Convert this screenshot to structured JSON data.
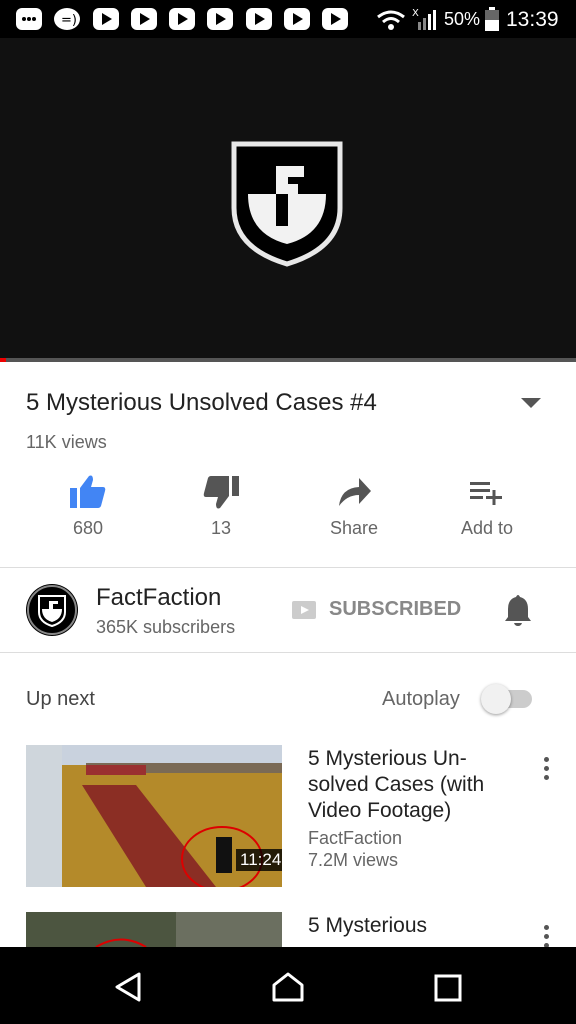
{
  "status_bar": {
    "battery": "50%",
    "time": "13:39",
    "icons": [
      "chat-icon",
      "messenger-icon",
      "youtube-icon",
      "youtube-icon",
      "youtube-icon",
      "youtube-icon",
      "youtube-icon",
      "youtube-icon",
      "youtube-icon",
      "wifi-icon",
      "signal-icon",
      "battery-icon"
    ]
  },
  "player": {
    "progress_fraction": 0.01,
    "logo": "factfaction-shield-logo"
  },
  "video": {
    "title": "5 Mysterious Unsolved Cases #4",
    "views": "11K views",
    "actions": {
      "like_count": "680",
      "dislike_count": "13",
      "share_label": "Share",
      "add_label": "Add to"
    }
  },
  "channel": {
    "name": "FactFaction",
    "subscribers": "365K subscribers",
    "subscribe_label": "SUBSCRIBED"
  },
  "up_next": {
    "heading": "Up next",
    "autoplay_label": "Autoplay",
    "autoplay_on": false,
    "items": [
      {
        "title": "5 Mysterious Un-solved Cases (with Video Footage)",
        "channel": "FactFaction",
        "views": "7.2M views",
        "duration": "11:24"
      },
      {
        "title": "5 Mysterious",
        "channel": "",
        "views": "",
        "duration": ""
      }
    ]
  },
  "colors": {
    "accent": "#4285f4",
    "progress": "#e00000"
  }
}
